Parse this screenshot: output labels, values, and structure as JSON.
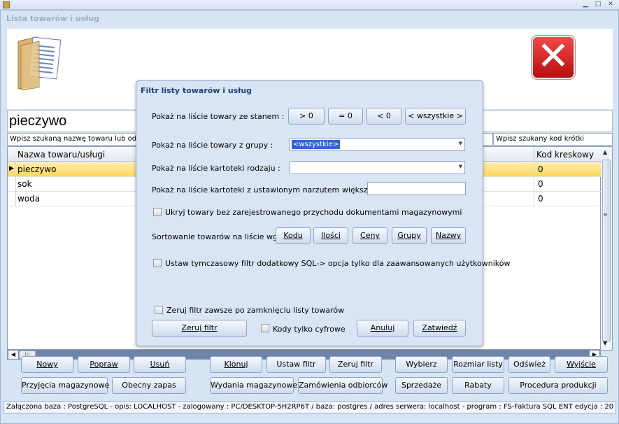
{
  "window": {
    "caption": "Lista towarów i usług"
  },
  "search": {
    "value": "pieczywo",
    "hint_name": "Wpisz szukaną nazwę towaru lub odcz",
    "hint_code": "Wpisz szukany kod krótki"
  },
  "grid": {
    "columns": [
      "Nazwa towaru/usługi",
      "Kod kreskowy"
    ],
    "rows": [
      {
        "name": "pieczywo",
        "code": "0"
      },
      {
        "name": "sok",
        "code": "0"
      },
      {
        "name": "woda",
        "code": "0"
      }
    ]
  },
  "dialog": {
    "title": "Filtr listy towarów i usług",
    "stock_label": "Pokaż na liście towary ze stanem :",
    "stock_buttons": [
      "> 0",
      "= 0",
      "< 0",
      "< wszystkie >"
    ],
    "group_label": "Pokaż na liście towary z grupy :",
    "group_value": "<wszystkie>",
    "kind_label": "Pokaż na liście kartoteki rodzaju :",
    "kind_value": "",
    "markup_label": "Pokaż na liście kartoteki z ustawionym narzutem większym od :",
    "markup_value": "",
    "hide_label": "Ukryj towary bez zarejestrowanego przychodu dokumentami magazynowymi",
    "sort_label": "Sortowanie towarów na liście wg :",
    "sort_buttons": [
      "Kodu",
      "Ilości",
      "Ceny",
      "Grupy",
      "Nazwy"
    ],
    "sql_label": "Ustaw tymczasowy filtr dodatkowy SQL-> opcja tylko dla zaawansowanych użytkowników",
    "reset_on_close_label": "Zeruj filtr zawsze po zamknięciu listy towarów",
    "reset_button": "Zeruj filtr",
    "digits_label": "Kody tylko cyfrowe",
    "cancel_button": "Anuluj",
    "confirm_button": "Zatwiedź"
  },
  "buttons": {
    "row1": [
      "Nowy",
      "Popraw",
      "Usuń",
      "Klonuj",
      "Ustaw filtr",
      "Zeruj filtr",
      "Wybierz",
      "Rozmiar listy",
      "Odśwież",
      "Wyjście"
    ],
    "row2": [
      "Przyjęcia magazynowe",
      "Obecny zapas",
      "Wydania magazynowe",
      "Zamówienia odbiorców",
      "Sprzedaże",
      "Rabaty",
      "Procedura produkcji"
    ]
  },
  "status": {
    "text": "Załączona baza : PostgreSQL - opis: LOCALHOST  -  zalogowany : PC/DESKTOP-5H2RP6T  / baza: postgres / adres serwera: localhost  -  program :  FS-Faktura SQL ENT edycja : 20"
  },
  "colors": {
    "selected_row": "#fcd85a",
    "dialog_title": "#1d4077",
    "close_red": "#d42020"
  }
}
